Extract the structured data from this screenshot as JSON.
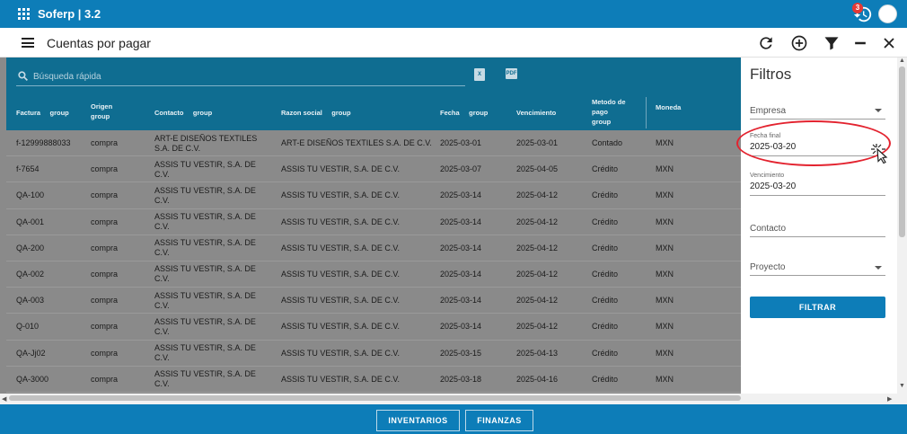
{
  "app": {
    "title": "Soferp | 3.2",
    "notification_count": "3"
  },
  "header": {
    "title": "Cuentas por pagar"
  },
  "search": {
    "placeholder": "Búsqueda rápida"
  },
  "columns": [
    {
      "l1": "Factura",
      "l2": "group"
    },
    {
      "l1": "Origen",
      "l2": "group"
    },
    {
      "l1": "Contacto",
      "l2": "group"
    },
    {
      "l1": "Razon social",
      "l2": "group"
    },
    {
      "l1": "Fecha",
      "l2": "group"
    },
    {
      "l1": "Vencimiento",
      "l2": ""
    },
    {
      "l1": "Metodo de pago",
      "l2": "group"
    },
    {
      "l1": "Moneda",
      "l2": ""
    }
  ],
  "rows": [
    {
      "factura": "f-12999888033",
      "origen": "compra",
      "contacto": "ART-E DISEÑOS TEXTILES S.A. DE C.V.",
      "razon": "ART-E DISEÑOS TEXTILES S.A. DE C.V.",
      "fecha": "2025-03-01",
      "venc": "2025-03-01",
      "metodo": "Contado",
      "moneda": "MXN"
    },
    {
      "factura": "f-7654",
      "origen": "compra",
      "contacto": "ASSIS TU VESTIR, S.A. DE C.V.",
      "razon": "ASSIS TU VESTIR, S.A. DE C.V.",
      "fecha": "2025-03-07",
      "venc": "2025-04-05",
      "metodo": "Crédito",
      "moneda": "MXN"
    },
    {
      "factura": "QA-100",
      "origen": "compra",
      "contacto": "ASSIS TU VESTIR, S.A. DE C.V.",
      "razon": "ASSIS TU VESTIR, S.A. DE C.V.",
      "fecha": "2025-03-14",
      "venc": "2025-04-12",
      "metodo": "Crédito",
      "moneda": "MXN"
    },
    {
      "factura": "QA-001",
      "origen": "compra",
      "contacto": "ASSIS TU VESTIR, S.A. DE C.V.",
      "razon": "ASSIS TU VESTIR, S.A. DE C.V.",
      "fecha": "2025-03-14",
      "venc": "2025-04-12",
      "metodo": "Crédito",
      "moneda": "MXN"
    },
    {
      "factura": "QA-200",
      "origen": "compra",
      "contacto": "ASSIS TU VESTIR, S.A. DE C.V.",
      "razon": "ASSIS TU VESTIR, S.A. DE C.V.",
      "fecha": "2025-03-14",
      "venc": "2025-04-12",
      "metodo": "Crédito",
      "moneda": "MXN"
    },
    {
      "factura": "QA-002",
      "origen": "compra",
      "contacto": "ASSIS TU VESTIR, S.A. DE C.V.",
      "razon": "ASSIS TU VESTIR, S.A. DE C.V.",
      "fecha": "2025-03-14",
      "venc": "2025-04-12",
      "metodo": "Crédito",
      "moneda": "MXN"
    },
    {
      "factura": "QA-003",
      "origen": "compra",
      "contacto": "ASSIS TU VESTIR, S.A. DE C.V.",
      "razon": "ASSIS TU VESTIR, S.A. DE C.V.",
      "fecha": "2025-03-14",
      "venc": "2025-04-12",
      "metodo": "Crédito",
      "moneda": "MXN"
    },
    {
      "factura": "Q-010",
      "origen": "compra",
      "contacto": "ASSIS TU VESTIR, S.A. DE C.V.",
      "razon": "ASSIS TU VESTIR, S.A. DE C.V.",
      "fecha": "2025-03-14",
      "venc": "2025-04-12",
      "metodo": "Crédito",
      "moneda": "MXN"
    },
    {
      "factura": "QA-Jj02",
      "origen": "compra",
      "contacto": "ASSIS TU VESTIR, S.A. DE C.V.",
      "razon": "ASSIS TU VESTIR, S.A. DE C.V.",
      "fecha": "2025-03-15",
      "venc": "2025-04-13",
      "metodo": "Crédito",
      "moneda": "MXN"
    },
    {
      "factura": "QA-3000",
      "origen": "compra",
      "contacto": "ASSIS TU VESTIR, S.A. DE C.V.",
      "razon": "ASSIS TU VESTIR, S.A. DE C.V.",
      "fecha": "2025-03-18",
      "venc": "2025-04-16",
      "metodo": "Crédito",
      "moneda": "MXN"
    }
  ],
  "filters": {
    "title": "Filtros",
    "empresa_label": "Empresa",
    "fecha_final_label": "Fecha final",
    "fecha_final_value": "2025-03-20",
    "vencimiento_label": "Vencimiento",
    "vencimiento_value": "2025-03-20",
    "contacto_label": "Contacto",
    "proyecto_label": "Proyecto",
    "filter_button": "FILTRAR"
  },
  "footer": {
    "btn1": "INVENTARIOS",
    "btn2": "FINANZAS"
  }
}
